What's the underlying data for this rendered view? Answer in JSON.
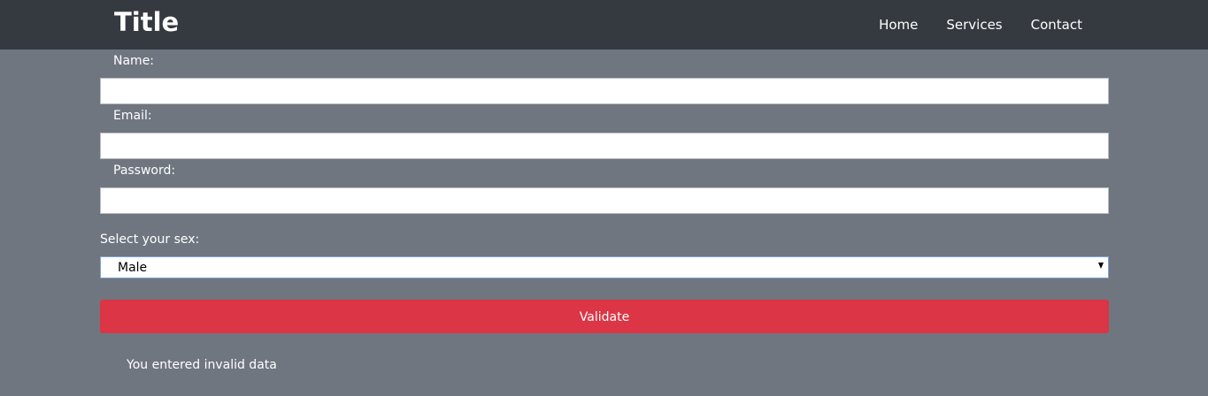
{
  "header": {
    "title": "Title",
    "nav": [
      "Home",
      "Services",
      "Contact"
    ]
  },
  "form": {
    "name_label": "Name:",
    "email_label": "Email:",
    "password_label": "Password:",
    "sex_label": "Select your sex:",
    "sex_selected": "Male",
    "validate_label": "Validate"
  },
  "message": "You entered invalid data",
  "colors": {
    "navbar": "#343a40",
    "background": "#6f767f",
    "button": "#dc3545"
  }
}
